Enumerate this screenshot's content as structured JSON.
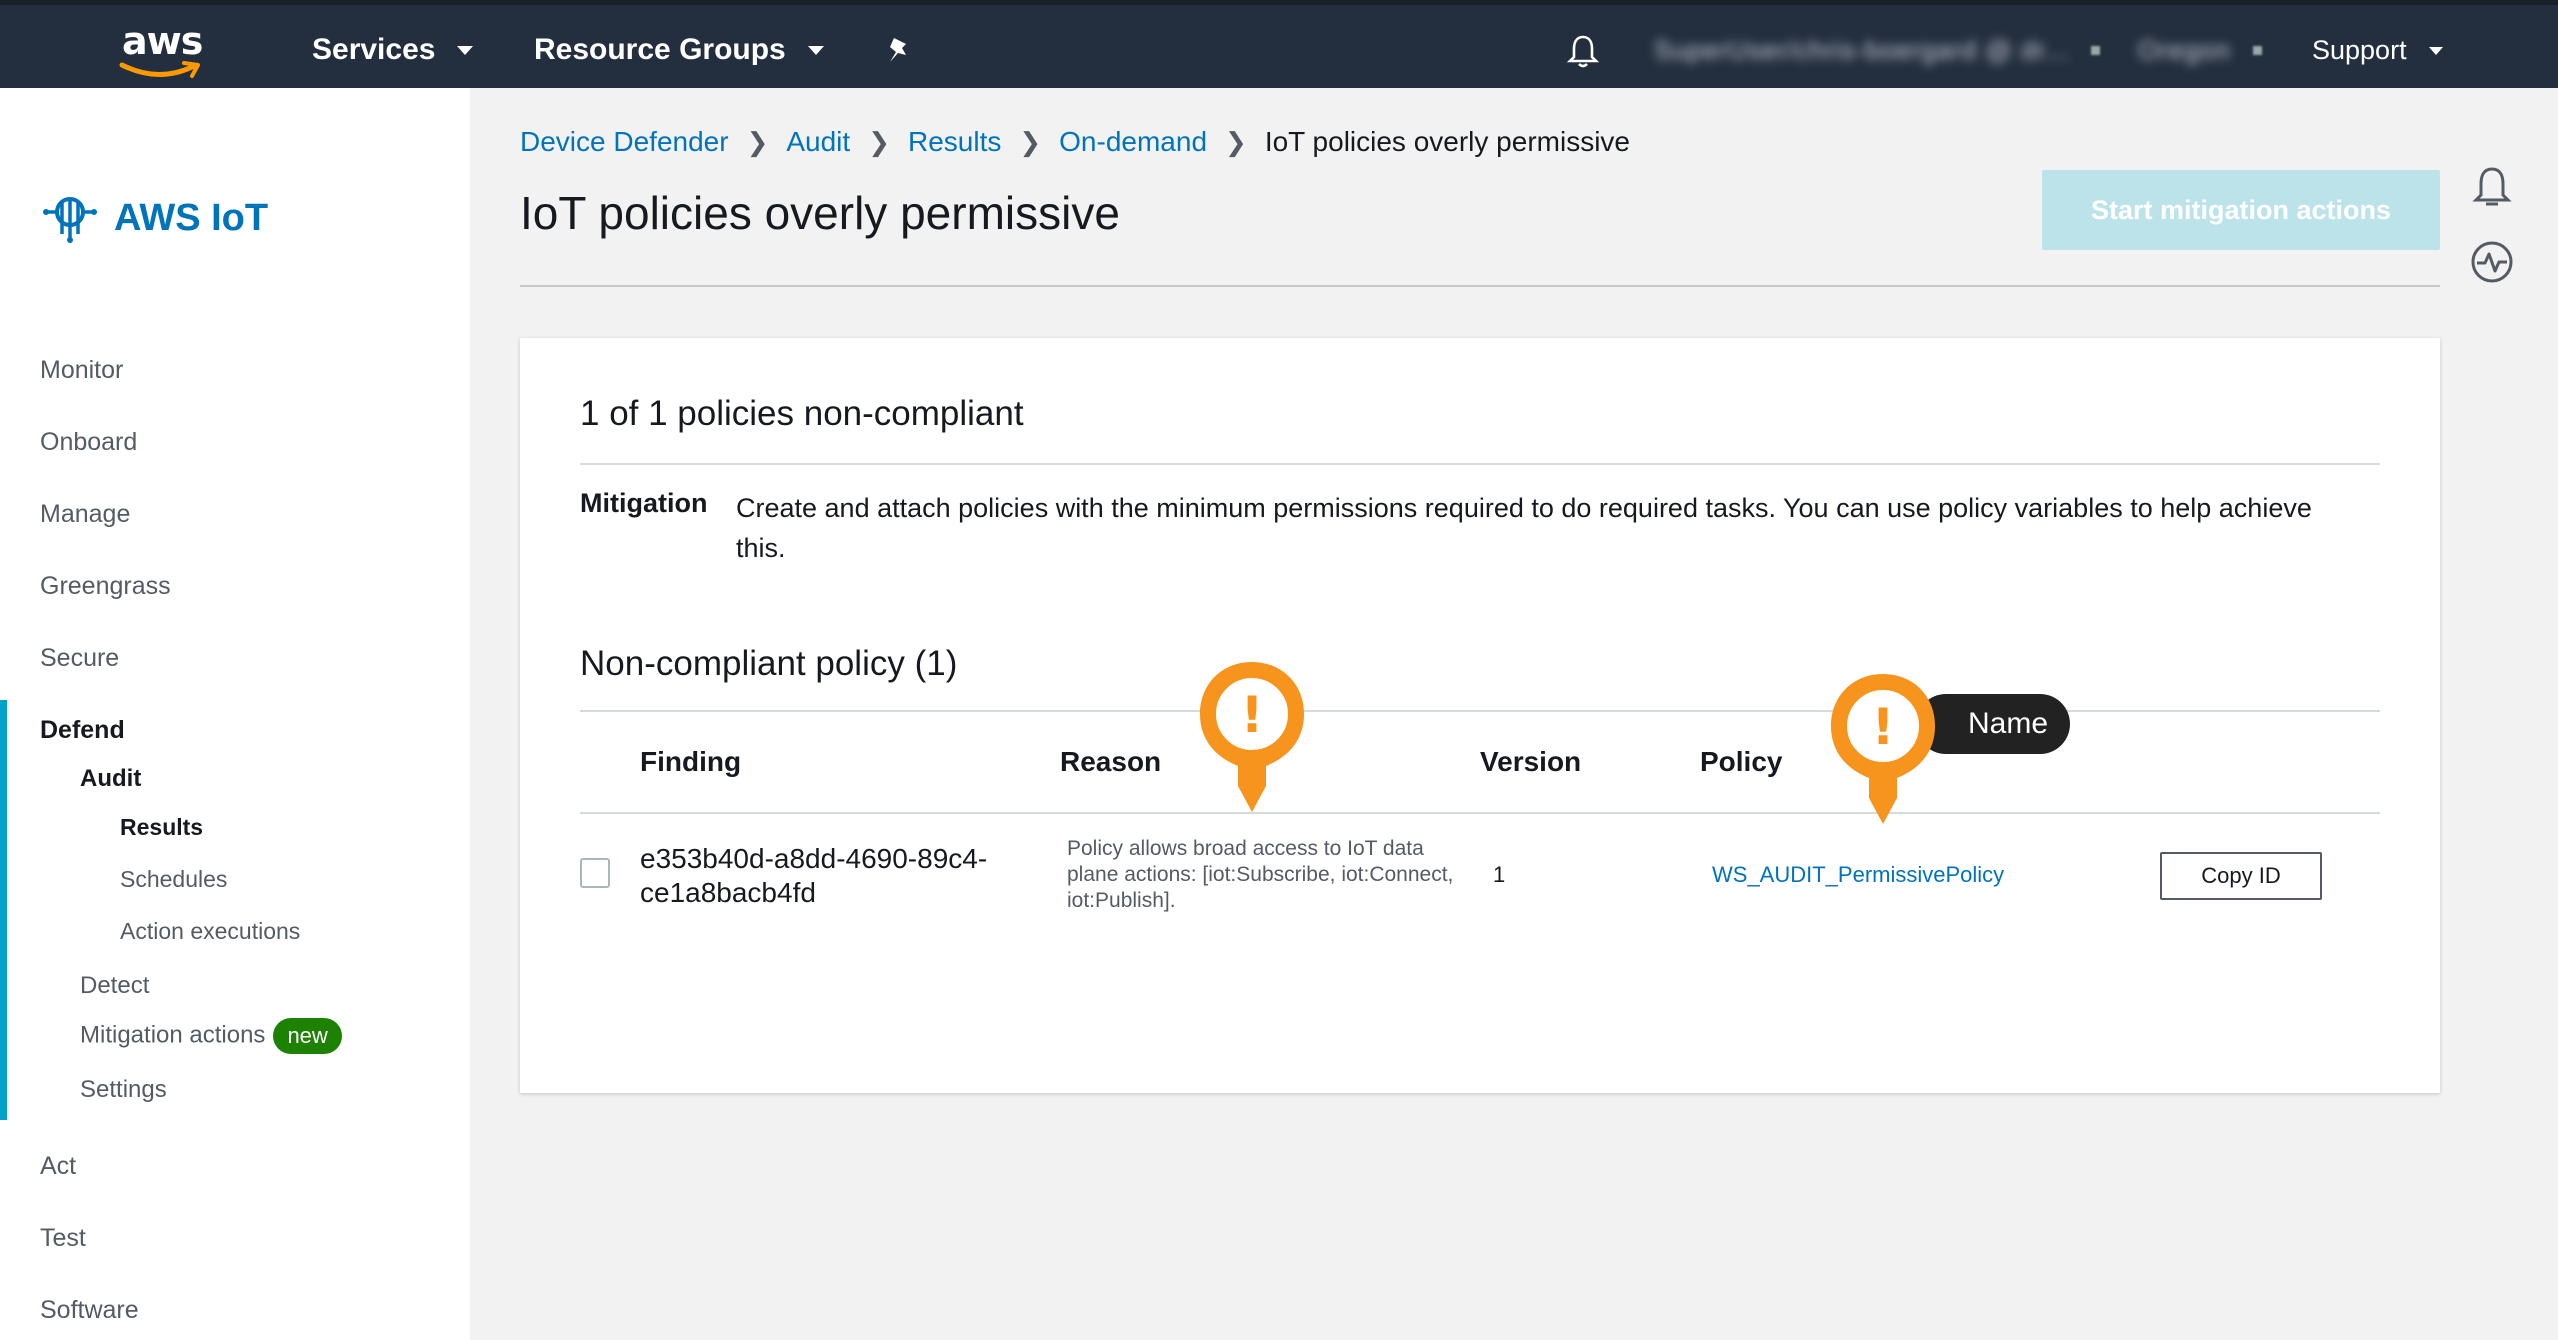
{
  "topnav": {
    "logo_text": "aws",
    "services": "Services",
    "resource_groups": "Resource Groups",
    "account": "SuperUser/chris-boergard @ dr...",
    "region": "Oregon",
    "support": "Support"
  },
  "sidebar": {
    "brand": "AWS IoT",
    "items": {
      "monitor": "Monitor",
      "onboard": "Onboard",
      "manage": "Manage",
      "greengrass": "Greengrass",
      "secure": "Secure",
      "defend": "Defend",
      "audit": "Audit",
      "results": "Results",
      "schedules": "Schedules",
      "action_executions": "Action executions",
      "detect": "Detect",
      "mitigation_actions": "Mitigation actions",
      "new_badge": "new",
      "settings": "Settings",
      "act": "Act",
      "test": "Test",
      "software": "Software"
    }
  },
  "breadcrumb": {
    "device_defender": "Device Defender",
    "audit": "Audit",
    "results": "Results",
    "on_demand": "On-demand",
    "current": "IoT policies overly permissive"
  },
  "page": {
    "title": "IoT policies overly permissive",
    "start_mitigation": "Start mitigation actions"
  },
  "card": {
    "heading": "1 of 1 policies non-compliant",
    "mitigation_label": "Mitigation",
    "mitigation_text": "Create and attach policies with the minimum permissions required to do required tasks. You can use policy variables to help achieve this.",
    "subheading": "Non-compliant policy (1)",
    "columns": {
      "finding": "Finding",
      "reason": "Reason",
      "version": "Version",
      "policy": "Policy"
    },
    "row": {
      "finding": "e353b40d-a8dd-4690-89c4-ce1a8bacb4fd",
      "reason": "Policy allows broad access to IoT data plane actions: [iot:Subscribe, iot:Connect, iot:Publish].",
      "version": "1",
      "policy": "WS_AUDIT_PermissivePolicy",
      "copy_id": "Copy ID"
    }
  },
  "annotations": {
    "marker_glyph": "!",
    "name_tag": "Name"
  },
  "colors": {
    "nav_bg": "#232f3e",
    "link": "#0073bb",
    "accent": "#00a1c9",
    "marker": "#f7941d",
    "badge": "#1d8102"
  }
}
